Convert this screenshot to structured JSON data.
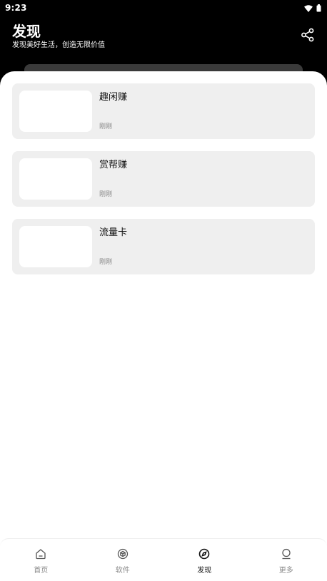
{
  "status_bar": {
    "time": "9:23"
  },
  "header": {
    "title": "发现",
    "subtitle": "发现美好生活，创造无限价值"
  },
  "cards": [
    {
      "title": "趣闲赚",
      "time": "刚刚"
    },
    {
      "title": "赏帮赚",
      "time": "刚刚"
    },
    {
      "title": "流量卡",
      "time": "刚刚"
    }
  ],
  "bottom_nav": {
    "items": [
      {
        "label": "首页",
        "icon": "home-icon",
        "active": false
      },
      {
        "label": "软件",
        "icon": "cube-icon",
        "active": false
      },
      {
        "label": "发现",
        "icon": "compass-icon",
        "active": true
      },
      {
        "label": "更多",
        "icon": "user-icon",
        "active": false
      }
    ]
  },
  "colors": {
    "header_bg": "#000000",
    "card_bg": "#efefef",
    "active_nav": "#111111",
    "inactive_nav": "#888888"
  }
}
